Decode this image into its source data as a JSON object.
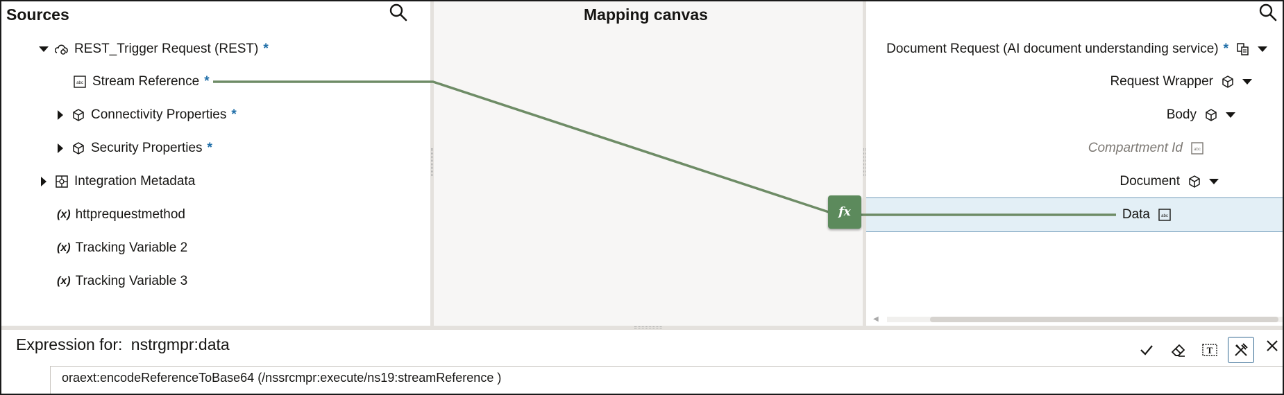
{
  "sources": {
    "title": "Sources",
    "items": [
      {
        "label": "REST_Trigger Request (REST)",
        "required": "*"
      },
      {
        "label": "Stream Reference",
        "required": "*"
      },
      {
        "label": "Connectivity Properties",
        "required": "*"
      },
      {
        "label": "Security Properties",
        "required": "*"
      },
      {
        "label": "Integration Metadata"
      },
      {
        "label": "httprequestmethod",
        "var": "(x)"
      },
      {
        "label": "Tracking Variable 2",
        "var": "(x)"
      },
      {
        "label": "Tracking Variable 3",
        "var": "(x)"
      }
    ]
  },
  "canvas": {
    "title": "Mapping canvas",
    "function_label": "fx"
  },
  "target": {
    "items": [
      {
        "label": "Document Request (AI document understanding service)",
        "required": "*"
      },
      {
        "label": "Request Wrapper"
      },
      {
        "label": "Body"
      },
      {
        "label": "Compartment Id"
      },
      {
        "label": "Document"
      },
      {
        "label": "Data"
      }
    ]
  },
  "expression": {
    "label": "Expression for:",
    "target": "nstrgmpr:data",
    "value": "oraext:encodeReferenceToBase64 (/nssrcmpr:execute/ns19:streamReference )"
  },
  "colors": {
    "mapping_line": "#6e8c66",
    "required_star": "#1f6ea8",
    "selected_row": "#e3eff6"
  },
  "icons": [
    "search-icon",
    "expand-icon",
    "collapse-icon",
    "rest-icon",
    "string-icon",
    "object-icon",
    "metadata-icon",
    "check-icon",
    "eraser-icon",
    "text-icon",
    "tools-icon",
    "close-icon",
    "caret-down-icon",
    "function-icon",
    "schema-icon"
  ]
}
